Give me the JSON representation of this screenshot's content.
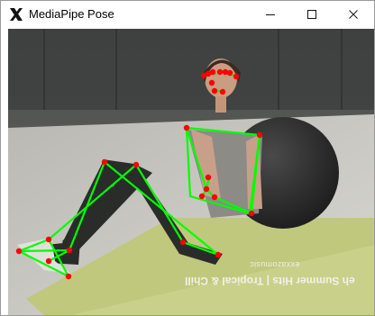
{
  "window": {
    "title": "MediaPipe Pose",
    "app_icon": "opencv-x-icon",
    "controls": {
      "minimize_icon": "minimize-icon",
      "maximize_icon": "maximize-icon",
      "close_icon": "close-icon"
    }
  },
  "video": {
    "overlay_small": "exxazomusic",
    "overlay_large": "eh Summer Hits | Tropical & Chill"
  },
  "pose_colors": {
    "connection": "#00ff00",
    "landmark": "#ff0000"
  }
}
